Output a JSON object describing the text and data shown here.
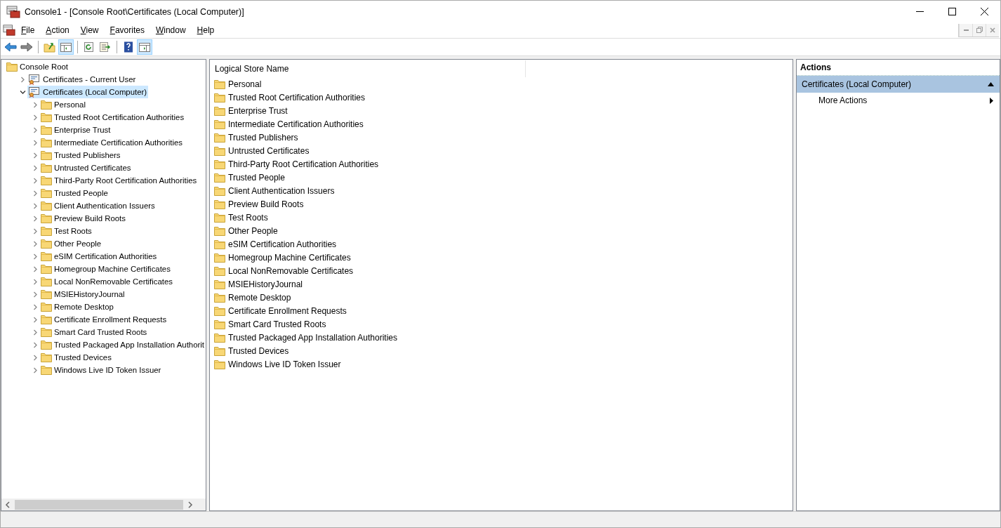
{
  "window": {
    "title": "Console1 - [Console Root\\Certificates (Local Computer)]"
  },
  "menu": [
    "File",
    "Action",
    "View",
    "Favorites",
    "Window",
    "Help"
  ],
  "toolbar": [
    {
      "kind": "back",
      "pressed": false
    },
    {
      "kind": "forward",
      "pressed": false
    },
    {
      "kind": "separator"
    },
    {
      "kind": "up",
      "pressed": false
    },
    {
      "kind": "tree-pane",
      "pressed": true
    },
    {
      "kind": "separator"
    },
    {
      "kind": "refresh",
      "pressed": false
    },
    {
      "kind": "export",
      "pressed": false
    },
    {
      "kind": "separator"
    },
    {
      "kind": "help",
      "pressed": false
    },
    {
      "kind": "action-pane",
      "pressed": true
    }
  ],
  "tree": {
    "label": "Console Root",
    "selected": false,
    "children": [
      {
        "label": "Certificates - Current User",
        "expanded": false,
        "selected": false
      },
      {
        "label": "Certificates (Local Computer)",
        "expanded": true,
        "selected": true,
        "children": [
          {
            "label": "Personal",
            "expanded": false,
            "selected": false
          },
          {
            "label": "Trusted Root Certification Authorities",
            "expanded": false,
            "selected": false
          },
          {
            "label": "Enterprise Trust",
            "expanded": false,
            "selected": false
          },
          {
            "label": "Intermediate Certification Authorities",
            "expanded": false,
            "selected": false
          },
          {
            "label": "Trusted Publishers",
            "expanded": false,
            "selected": false
          },
          {
            "label": "Untrusted Certificates",
            "expanded": false,
            "selected": false
          },
          {
            "label": "Third-Party Root Certification Authorities",
            "expanded": false,
            "selected": false
          },
          {
            "label": "Trusted People",
            "expanded": false,
            "selected": false
          },
          {
            "label": "Client Authentication Issuers",
            "expanded": false,
            "selected": false
          },
          {
            "label": "Preview Build Roots",
            "expanded": false,
            "selected": false
          },
          {
            "label": "Test Roots",
            "expanded": false,
            "selected": false
          },
          {
            "label": "Other People",
            "expanded": false,
            "selected": false
          },
          {
            "label": "eSIM Certification Authorities",
            "expanded": false,
            "selected": false
          },
          {
            "label": "Homegroup Machine Certificates",
            "expanded": false,
            "selected": false
          },
          {
            "label": "Local NonRemovable Certificates",
            "expanded": false,
            "selected": false
          },
          {
            "label": "MSIEHistoryJournal",
            "expanded": false,
            "selected": false
          },
          {
            "label": "Remote Desktop",
            "expanded": false,
            "selected": false
          },
          {
            "label": "Certificate Enrollment Requests",
            "expanded": false,
            "selected": false
          },
          {
            "label": "Smart Card Trusted Roots",
            "expanded": false,
            "selected": false
          },
          {
            "label": "Trusted Packaged App Installation Authorit",
            "expanded": false,
            "selected": false
          },
          {
            "label": "Trusted Devices",
            "expanded": false,
            "selected": false
          },
          {
            "label": "Windows Live ID Token Issuer",
            "expanded": false,
            "selected": false
          }
        ]
      }
    ]
  },
  "list": {
    "columns": [
      "Logical Store Name"
    ],
    "rows": [
      "Personal",
      "Trusted Root Certification Authorities",
      "Enterprise Trust",
      "Intermediate Certification Authorities",
      "Trusted Publishers",
      "Untrusted Certificates",
      "Third-Party Root Certification Authorities",
      "Trusted People",
      "Client Authentication Issuers",
      "Preview Build Roots",
      "Test Roots",
      "Other People",
      "eSIM Certification Authorities",
      "Homegroup Machine Certificates",
      "Local NonRemovable Certificates",
      "MSIEHistoryJournal",
      "Remote Desktop",
      "Certificate Enrollment Requests",
      "Smart Card Trusted Roots",
      "Trusted Packaged App Installation Authorities",
      "Trusted Devices",
      "Windows Live ID Token Issuer"
    ]
  },
  "actions": {
    "title": "Actions",
    "sections": [
      {
        "title": "Certificates (Local Computer)",
        "expanded": true,
        "items": [
          {
            "label": "More Actions",
            "submenu": true
          }
        ]
      }
    ]
  }
}
